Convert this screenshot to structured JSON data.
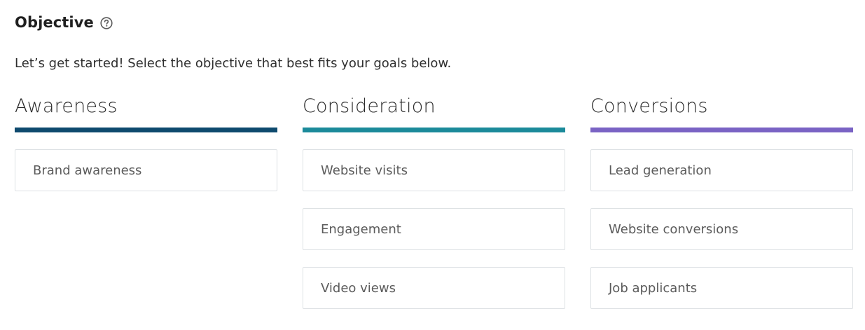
{
  "header": {
    "title": "Objective",
    "help_icon": "question-circle-icon"
  },
  "subtitle": "Let’s get started! Select the objective that best fits your goals below.",
  "columns": [
    {
      "heading": "Awareness",
      "color": "#0e4a6e",
      "options": [
        "Brand awareness"
      ]
    },
    {
      "heading": "Consideration",
      "color": "#1b8a9a",
      "options": [
        "Website visits",
        "Engagement",
        "Video views"
      ]
    },
    {
      "heading": "Conversions",
      "color": "#7a63c4",
      "options": [
        "Lead generation",
        "Website conversions",
        "Job applicants"
      ]
    }
  ]
}
